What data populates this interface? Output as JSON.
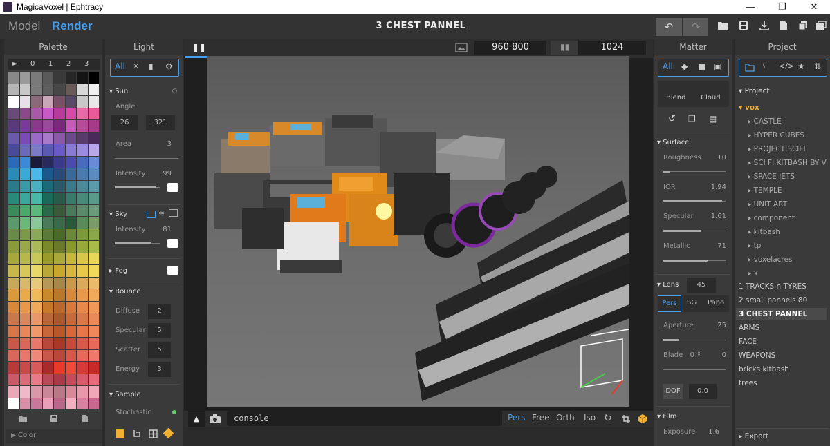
{
  "app": {
    "title": "MagicaVoxel | Ephtracy"
  },
  "window_controls": {
    "minimize": "—",
    "maximize": "❐",
    "close": "✕"
  },
  "menubar": {
    "mode_model": "Model",
    "mode_render": "Render",
    "file_title": "3 CHEST PANNEL",
    "tool_icons": [
      "undo-icon",
      "redo-icon",
      "open-folder-icon",
      "save-icon",
      "export-icon",
      "new-file-icon",
      "copy-icon",
      "snapshot-icon"
    ]
  },
  "palette": {
    "header": "Palette",
    "tabs": [
      "►",
      "0",
      "1",
      "2",
      "3"
    ],
    "footer_label": "Color",
    "colors": [
      "#888888",
      "#9a9a9a",
      "#7a7a7a",
      "#5a5a5a",
      "#3a3a3a",
      "#262626",
      "#141414",
      "#000000",
      "#b5b5b5",
      "#c8c8c8",
      "#7a7a7a",
      "#5e5e5e",
      "#474747",
      "#6a5a5a",
      "#d8d8d8",
      "#f0f0f0",
      "#ffffff",
      "#e7e0e8",
      "#8a6a7a",
      "#c8a8b8",
      "#785068",
      "#5a4a6a",
      "#c8c8c8",
      "#e8e8e8",
      "#6a4a7a",
      "#8a4a8a",
      "#a85aa8",
      "#c85ac8",
      "#b83a9a",
      "#d84aa8",
      "#e86aa8",
      "#ea5a9a",
      "#5a3a7a",
      "#7a3a9a",
      "#8a3a8a",
      "#9a4a9a",
      "#7a2a7a",
      "#c85ab8",
      "#b84a9a",
      "#a83a8a",
      "#6a5aaa",
      "#7a4ab8",
      "#9a6ac8",
      "#a87ac8",
      "#8a5aa8",
      "#6a4a8a",
      "#5a3a6a",
      "#4a2a5a",
      "#4a4a9a",
      "#6a6ab8",
      "#7a7ac8",
      "#5a5ab0",
      "#6a5ac8",
      "#8a7ad8",
      "#9a8ae0",
      "#b8a8e8",
      "#2a6ab8",
      "#3a8ad8",
      "#1a1a3a",
      "#2a2a5a",
      "#3a3a8a",
      "#4a4ab0",
      "#4a6ac0",
      "#6a8ad8",
      "#2a8ab8",
      "#3aa8d8",
      "#4ab8e8",
      "#1a5a8a",
      "#2a4a7a",
      "#3a6a9a",
      "#4a7ab0",
      "#5a8ac0",
      "#2a7a8a",
      "#3a9aa8",
      "#4ab0c0",
      "#1a6a7a",
      "#2a5a6a",
      "#3a7a8a",
      "#4a8a9a",
      "#5a9aaa",
      "#2a8a7a",
      "#3aa89a",
      "#4ab8a8",
      "#1a6a5a",
      "#2a5a4a",
      "#3a7a6a",
      "#4a8a7a",
      "#5a9a8a",
      "#3a8a5a",
      "#4aa86a",
      "#5ab87a",
      "#2a6a4a",
      "#3a5a3a",
      "#4a7a5a",
      "#5a8a6a",
      "#6a9a7a",
      "#5a9a6a",
      "#6ab87a",
      "#8ac89a",
      "#4a7a5a",
      "#3a6a4a",
      "#2a5a3a",
      "#5a8a5a",
      "#7a9a6a",
      "#6a8a4a",
      "#7a9a4a",
      "#8aa85a",
      "#5a7a3a",
      "#4a6a2a",
      "#6a8a3a",
      "#7a9a3a",
      "#8aa84a",
      "#8a9a3a",
      "#9aa84a",
      "#aab85a",
      "#7a8a2a",
      "#6a7a2a",
      "#8a9a2a",
      "#9aaa3a",
      "#aaba4a",
      "#a8a83a",
      "#b8b84a",
      "#c8c85a",
      "#9a9a2a",
      "#aaa83a",
      "#c8b83a",
      "#d8c84a",
      "#e8d85a",
      "#c8b84a",
      "#d8c85a",
      "#e8d86a",
      "#b8a83a",
      "#c8a82a",
      "#d8b83a",
      "#e8c84a",
      "#f0d85a",
      "#c8a85a",
      "#d8b86a",
      "#e8c87a",
      "#b8985a",
      "#a8884a",
      "#c89a4a",
      "#d8aa5a",
      "#e8ba6a",
      "#d89a3a",
      "#e8aa4a",
      "#f0ba5a",
      "#c88a2a",
      "#b87a2a",
      "#d88a3a",
      "#e89a4a",
      "#f0aa5a",
      "#d8883a",
      "#e8984a",
      "#f0a85a",
      "#c8782a",
      "#b8682a",
      "#d8783a",
      "#e8884a",
      "#f0985a",
      "#c8784a",
      "#d8885a",
      "#e8986a",
      "#b8683a",
      "#a8582a",
      "#c86a3a",
      "#d87a4a",
      "#e88a5a",
      "#d8784a",
      "#e8885a",
      "#f0986a",
      "#c8683a",
      "#b8582a",
      "#d8683a",
      "#e8784a",
      "#f0885a",
      "#c8584a",
      "#d8685a",
      "#e8786a",
      "#b8483a",
      "#a8382a",
      "#c8483a",
      "#d8584a",
      "#e8685a",
      "#d8685a",
      "#e8786a",
      "#f0887a",
      "#c8584a",
      "#b8483a",
      "#d8584a",
      "#e8685a",
      "#f0786a",
      "#b83a3a",
      "#c84a4a",
      "#d85a5a",
      "#a82a2a",
      "#e83a2a",
      "#f04a3a",
      "#d83a3a",
      "#c82a2a",
      "#c85a6a",
      "#d86a7a",
      "#e87a8a",
      "#b84a5a",
      "#a83a4a",
      "#c84a5a",
      "#d85a6a",
      "#e86a7a",
      "#e8a8b8",
      "#f0b8c8",
      "#d898a8",
      "#c88898",
      "#b87888",
      "#d88898",
      "#e898a8",
      "#f0a8b8",
      "#ffffff",
      "#d890a8",
      "#c87898",
      "#e8a0b8",
      "#b86888",
      "#f0b0c0",
      "#d880a0",
      "#c86890"
    ]
  },
  "light": {
    "header": "Light",
    "tabs": [
      "All",
      "sun-icon",
      "bars-icon",
      "gear-icon"
    ],
    "sun": {
      "title": "Sun",
      "angle_label": "Angle",
      "angle": [
        "26",
        "321"
      ],
      "area_label": "Area",
      "area": "3",
      "intensity_label": "Intensity",
      "intensity": "99",
      "intensity_level": 0.9
    },
    "sky": {
      "title": "Sky",
      "intensity_label": "Intensity",
      "intensity": "81",
      "intensity_level": 0.8
    },
    "fog": {
      "title": "Fog"
    },
    "bounce": {
      "title": "Bounce",
      "diffuse_label": "Diffuse",
      "diffuse": "2",
      "specular_label": "Specular",
      "specular": "5",
      "scatter_label": "Scatter",
      "scatter": "5",
      "energy_label": "Energy",
      "energy": "3"
    },
    "sample": {
      "title": "Sample",
      "stochastic_label": "Stochastic"
    }
  },
  "viewport": {
    "progress": 0.35,
    "resolution": "960  800",
    "samples": "1024",
    "console_placeholder": "console",
    "view_modes": [
      "Pers",
      "Free",
      "Orth",
      "Iso"
    ],
    "active_view": "Pers"
  },
  "matter": {
    "header": "Matter",
    "tabs": [
      "All",
      "cube-icon",
      "film-icon",
      "image-icon"
    ],
    "blend_label": "Blend",
    "cloud_label": "Cloud",
    "surface": {
      "title": "Surface",
      "roughness_label": "Roughness",
      "roughness": "10",
      "roughness_level": 0.1,
      "ior_label": "IOR",
      "ior": "1.94",
      "ior_level": 0.94,
      "specular_label": "Specular",
      "specular": "1.61",
      "specular_level": 0.61,
      "metallic_label": "Metallic",
      "metallic": "71",
      "metallic_level": 0.71
    },
    "lens": {
      "title": "Lens",
      "fov": "45",
      "modes": [
        "Pers",
        "SG",
        "Pano"
      ],
      "aperture_label": "Aperture",
      "aperture": "25",
      "aperture_level": 0.25,
      "blade_label": "Blade",
      "blade_count": "0",
      "blade_value": "0",
      "dof_label": "DOF",
      "dof": "0.0"
    },
    "film": {
      "title": "Film",
      "exposure_label": "Exposure",
      "exposure": "1.6"
    }
  },
  "project": {
    "header": "Project",
    "tree_title": "Project",
    "root": "vox",
    "folders": [
      "CASTLE",
      "HYPER CUBES",
      "PROJECT SCIFI",
      "SCI FI KITBASH BY V",
      "SPACE JETS",
      "TEMPLE",
      "UNIT ART",
      "component",
      "kitbash",
      "tp",
      "voxelacres",
      "x"
    ],
    "files": [
      "1 TRACKS n TYRES",
      "2 small  pannels 80",
      "3 CHEST PANNEL",
      "ARMS",
      "FACE",
      "WEAPONS",
      "bricks kitbash",
      "trees"
    ],
    "selected": "3 CHEST PANNEL",
    "export_label": "Export"
  },
  "colors": {
    "accent": "#4a9de8",
    "selected_swatch": "#c8782a"
  }
}
